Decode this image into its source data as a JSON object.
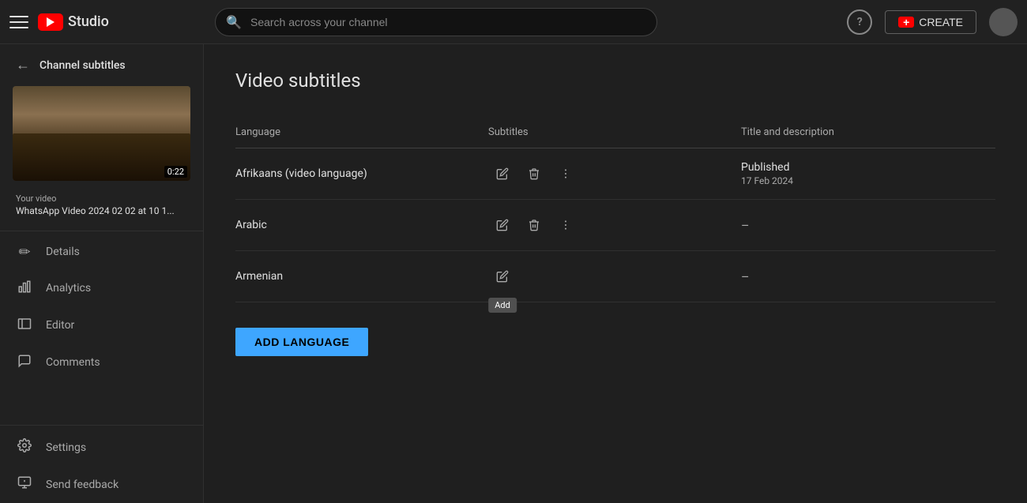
{
  "header": {
    "logo_text": "Studio",
    "search_placeholder": "Search across your channel",
    "help_label": "?",
    "create_label": "CREATE",
    "avatar_label": "User avatar"
  },
  "sidebar": {
    "back_label": "Channel subtitles",
    "video": {
      "duration": "0:22",
      "label": "Your video",
      "title": "WhatsApp Video 2024 02 02 at 10 1..."
    },
    "nav_items": [
      {
        "id": "details",
        "icon": "✏",
        "label": "Details"
      },
      {
        "id": "analytics",
        "icon": "📊",
        "label": "Analytics"
      },
      {
        "id": "editor",
        "icon": "🎬",
        "label": "Editor"
      },
      {
        "id": "comments",
        "icon": "💬",
        "label": "Comments"
      }
    ],
    "bottom_items": [
      {
        "id": "settings",
        "icon": "⚙",
        "label": "Settings"
      },
      {
        "id": "feedback",
        "icon": "⚠",
        "label": "Send feedback"
      }
    ]
  },
  "main": {
    "page_title": "Video subtitles",
    "table": {
      "columns": [
        {
          "id": "language",
          "label": "Language"
        },
        {
          "id": "subtitles",
          "label": "Subtitles"
        },
        {
          "id": "title_desc",
          "label": "Title and description"
        }
      ],
      "rows": [
        {
          "language": "Afrikaans (video language)",
          "has_edit": true,
          "has_delete": true,
          "has_more": true,
          "has_add_tooltip": false,
          "title_status": "Published",
          "title_date": "17 Feb 2024",
          "dash": false
        },
        {
          "language": "Arabic",
          "has_edit": true,
          "has_delete": true,
          "has_more": true,
          "has_add_tooltip": false,
          "title_status": "",
          "title_date": "",
          "dash": true
        },
        {
          "language": "Armenian",
          "has_edit": true,
          "has_delete": false,
          "has_more": false,
          "has_add_tooltip": true,
          "add_tooltip_text": "Add",
          "title_status": "",
          "title_date": "",
          "dash": true
        }
      ]
    },
    "add_language_btn": "ADD LANGUAGE"
  }
}
